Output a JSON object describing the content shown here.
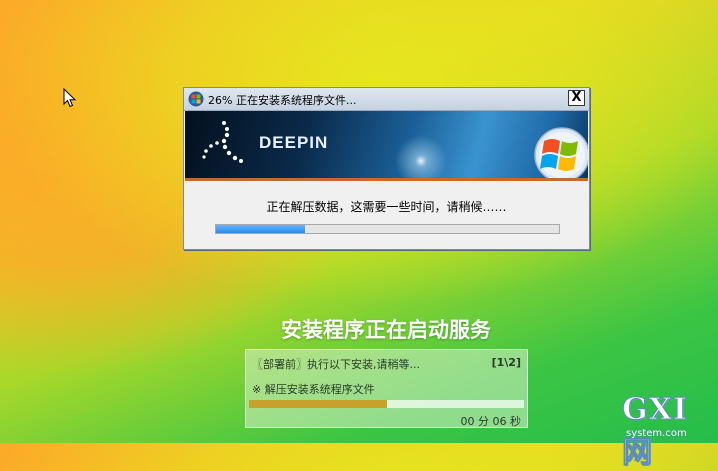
{
  "dialog": {
    "title": "26% 正在安装系统程序文件...",
    "close_label": "X",
    "banner": {
      "brand": "DEEPIN"
    },
    "status": "正在解压数据，这需要一些时间，请稍候……",
    "progress": 0.26
  },
  "bottom": {
    "title": "安装程序正在启动服务",
    "line1": "〖部署前〗执行以下安装,请稍等...",
    "counter": "[1\\2]",
    "line2": "※ 解压安装系统程序文件",
    "progress": 0.5,
    "time": "00 分 06 秒"
  },
  "watermark": {
    "main": "GXI网",
    "sub": "system.com"
  },
  "colors": {
    "accent_blue": "#2f8ae6",
    "panel_bar": "#c8a02c"
  },
  "icons": [
    "cursor-arrow",
    "windows-logo",
    "close-icon",
    "deepin-logo"
  ]
}
